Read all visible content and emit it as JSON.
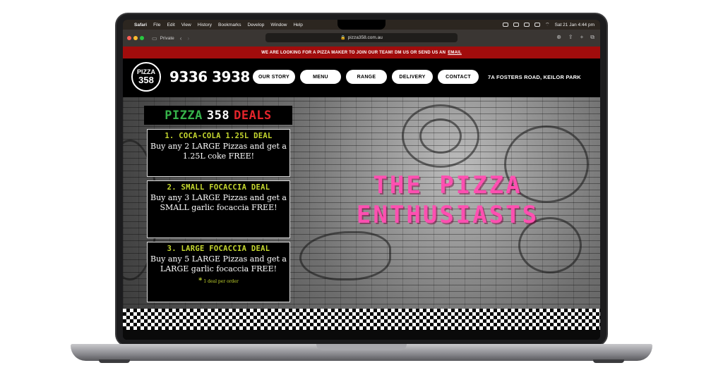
{
  "menubar": {
    "apple": "",
    "items": [
      "Safari",
      "File",
      "Edit",
      "View",
      "History",
      "Bookmarks",
      "Develop",
      "Window",
      "Help"
    ],
    "datetime": "Sat 21 Jan  4:44 pm"
  },
  "browser": {
    "mode_label": "Private",
    "url": "pizza358.com.au",
    "traffic_colors": [
      "#ff5f57",
      "#febc2e",
      "#28c840"
    ]
  },
  "announcement": {
    "text": "WE ARE LOOKING FOR A PIZZA MAKER TO JOIN OUR TEAM! DM US OR SEND US AN",
    "link": "EMAIL"
  },
  "header": {
    "logo_top": "PIZZA",
    "logo_bottom": "358",
    "phone": "9336 3938",
    "nav": [
      "OUR STORY",
      "MENU",
      "RANGE",
      "DELIVERY",
      "CONTACT"
    ],
    "address": "7A FOSTERS ROAD, KEILOR PARK"
  },
  "deals": {
    "heading_a": "PIZZA",
    "heading_b": "358",
    "heading_c": "DEALS",
    "items": [
      {
        "title": "1. COCA-COLA 1.25L DEAL",
        "body": "Buy any 2 LARGE Pizzas and get a 1.25L coke FREE!"
      },
      {
        "title": "2. SMALL FOCACCIA DEAL",
        "body": "Buy any 3 LARGE Pizzas and get a SMALL garlic focaccia FREE!"
      },
      {
        "title": "3. LARGE FOCACCIA DEAL",
        "body": "Buy any 5 LARGE Pizzas and get a LARGE garlic focaccia FREE!"
      }
    ],
    "note_star": "*",
    "note": "1 deal per order"
  },
  "hero": {
    "line1": "THE PIZZA",
    "line2": "ENTHUSIASTS"
  },
  "colors": {
    "announce_bg": "#a10c0c",
    "hero_title": "#ff4fb1",
    "deal_title": "#c6d82f",
    "green": "#36b34a",
    "red": "#e3242b"
  }
}
